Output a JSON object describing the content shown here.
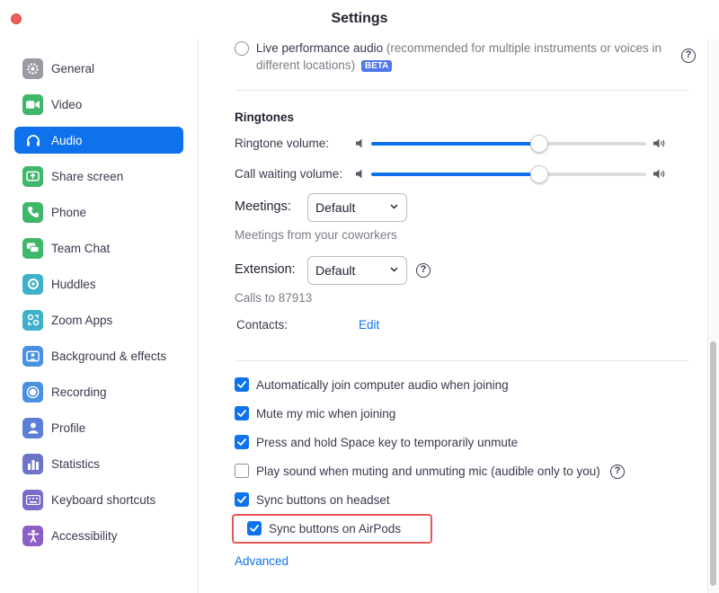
{
  "window": {
    "title": "Settings"
  },
  "sidebar": {
    "items": [
      {
        "label": "General",
        "icon": "gear-icon",
        "color": "#9a9aa3",
        "active": false
      },
      {
        "label": "Video",
        "icon": "video-camera-icon",
        "color": "#3fb76b",
        "active": false
      },
      {
        "label": "Audio",
        "icon": "headphones-icon",
        "color": "#0e72ed",
        "active": true
      },
      {
        "label": "Share screen",
        "icon": "share-screen-icon",
        "color": "#3fb76b",
        "active": false
      },
      {
        "label": "Phone",
        "icon": "phone-icon",
        "color": "#3fb76b",
        "active": false
      },
      {
        "label": "Team Chat",
        "icon": "chat-bubbles-icon",
        "color": "#3fb76b",
        "active": false
      },
      {
        "label": "Huddles",
        "icon": "huddles-icon",
        "color": "#3fb0c9",
        "active": false
      },
      {
        "label": "Zoom Apps",
        "icon": "apps-icon",
        "color": "#3fb0c9",
        "active": false
      },
      {
        "label": "Background & effects",
        "icon": "background-person-icon",
        "color": "#4a90e2",
        "active": false
      },
      {
        "label": "Recording",
        "icon": "record-icon",
        "color": "#4a90e2",
        "active": false
      },
      {
        "label": "Profile",
        "icon": "profile-icon",
        "color": "#5b7fd6",
        "active": false
      },
      {
        "label": "Statistics",
        "icon": "statistics-bars-icon",
        "color": "#6c73c9",
        "active": false
      },
      {
        "label": "Keyboard shortcuts",
        "icon": "keyboard-icon",
        "color": "#7b6cc9",
        "active": false
      },
      {
        "label": "Accessibility",
        "icon": "accessibility-icon",
        "color": "#8d5fc6",
        "active": false
      }
    ]
  },
  "live_audio": {
    "label": "Live performance audio",
    "description": "(recommended for multiple instruments or voices in",
    "description_line2": "different locations)",
    "badge": "BETA",
    "help": "?"
  },
  "ringtones": {
    "title": "Ringtones",
    "ringtone_volume_label": "Ringtone volume:",
    "ringtone_volume": 0.61,
    "call_waiting_label": "Call waiting volume:",
    "call_waiting_volume": 0.61,
    "meetings_label": "Meetings:",
    "meetings_value": "Default",
    "meetings_hint": "Meetings from your coworkers",
    "extension_label": "Extension:",
    "extension_value": "Default",
    "extension_help": "?",
    "extension_hint": "Calls to 87913",
    "contacts_label": "Contacts:",
    "contacts_edit": "Edit"
  },
  "options": [
    {
      "label": "Automatically join computer audio when joining",
      "checked": true
    },
    {
      "label": "Mute my mic when joining",
      "checked": true
    },
    {
      "label": "Press and hold Space key to temporarily unmute",
      "checked": true
    },
    {
      "label": "Play sound when muting and unmuting mic (audible only to you)",
      "checked": false
    },
    {
      "label": "Sync buttons on headset",
      "checked": true
    },
    {
      "label": "Sync buttons on AirPods",
      "checked": true
    }
  ],
  "play_sound_help": "?",
  "advanced_link": "Advanced",
  "colors": {
    "accent": "#0e72ed",
    "highlight": "#e35757"
  }
}
